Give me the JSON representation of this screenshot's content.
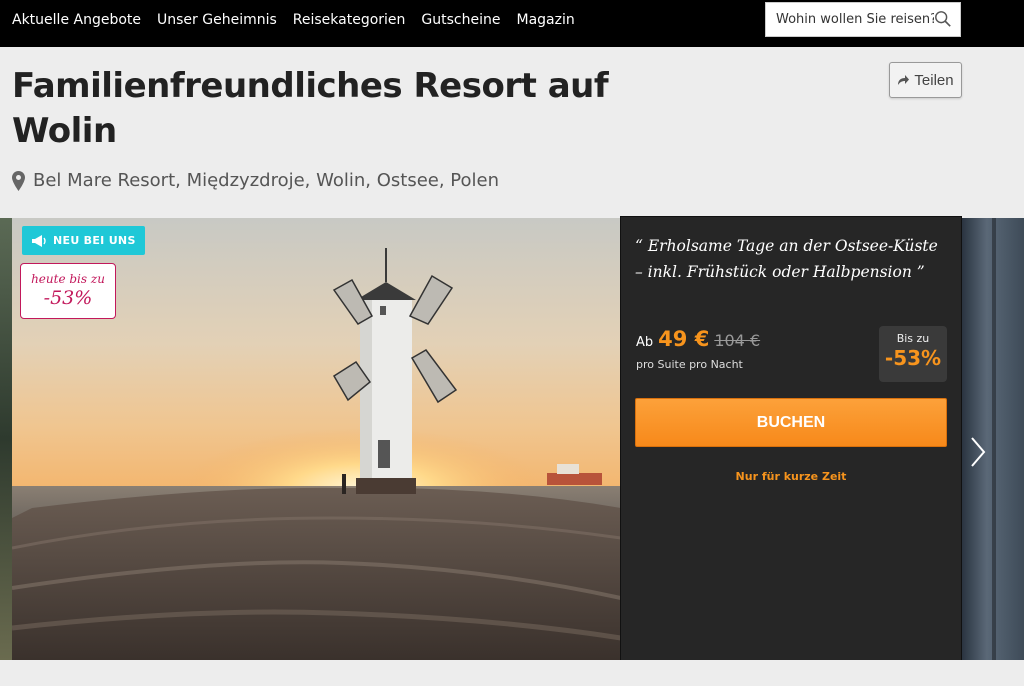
{
  "nav": {
    "items": [
      "Aktuelle Angebote",
      "Unser Geheimnis",
      "Reisekategorien",
      "Gutscheine",
      "Magazin"
    ],
    "search_placeholder": "Wohin wollen Sie reisen?"
  },
  "header": {
    "title": "Familienfreundliches Resort auf Wolin",
    "share_label": "Teilen",
    "location": "Bel Mare Resort, Międzyzdroje, Wolin, Ostsee, Polen"
  },
  "hero": {
    "new_badge": "NEU BEI UNS",
    "discount_badge_line1": "heute bis zu",
    "discount_badge_line2": "-53%"
  },
  "offer": {
    "quote": "“ Erholsame Tage an der Ostsee-Küste – inkl. Frühstück oder Halbpension ”",
    "ab_label": "Ab",
    "price": "49 €",
    "old_price": "104 €",
    "per_label": "pro Suite pro Nacht",
    "save_label": "Bis zu",
    "save_value": "-53%",
    "book_label": "BUCHEN",
    "limited_label": "Nur für kurze Zeit"
  },
  "colors": {
    "accent_orange": "#f7941d",
    "badge_cyan": "#1fc8d7",
    "badge_pink": "#c2185b",
    "panel_bg": "#262626"
  },
  "icons": [
    "search-icon",
    "share-icon",
    "location-pin-icon",
    "megaphone-icon",
    "chevron-right-icon"
  ]
}
